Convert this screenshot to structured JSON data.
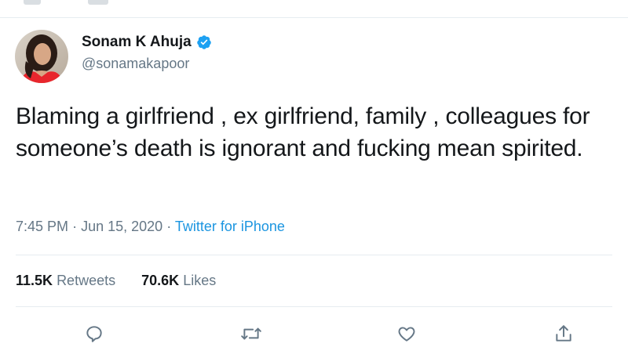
{
  "tweet": {
    "display_name": "Sonam K Ahuja",
    "handle": "@sonamakapoor",
    "verified": true,
    "text": "Blaming a girlfriend , ex girlfriend, family , colleagues for someone’s death is ignorant and fucking mean spirited.",
    "time": "7:45 PM",
    "date": "Jun 15, 2020",
    "separator": "·",
    "source": "Twitter for iPhone"
  },
  "stats": {
    "retweets_count": "11.5K",
    "retweets_label": "Retweets",
    "likes_count": "70.6K",
    "likes_label": "Likes"
  },
  "actions": [
    "reply-icon",
    "retweet-icon",
    "like-icon",
    "share-icon"
  ],
  "colors": {
    "text": "#14171a",
    "secondary": "#657786",
    "link": "#1b95e0",
    "verified": "#1da1f2",
    "border": "#e6ecf0"
  }
}
